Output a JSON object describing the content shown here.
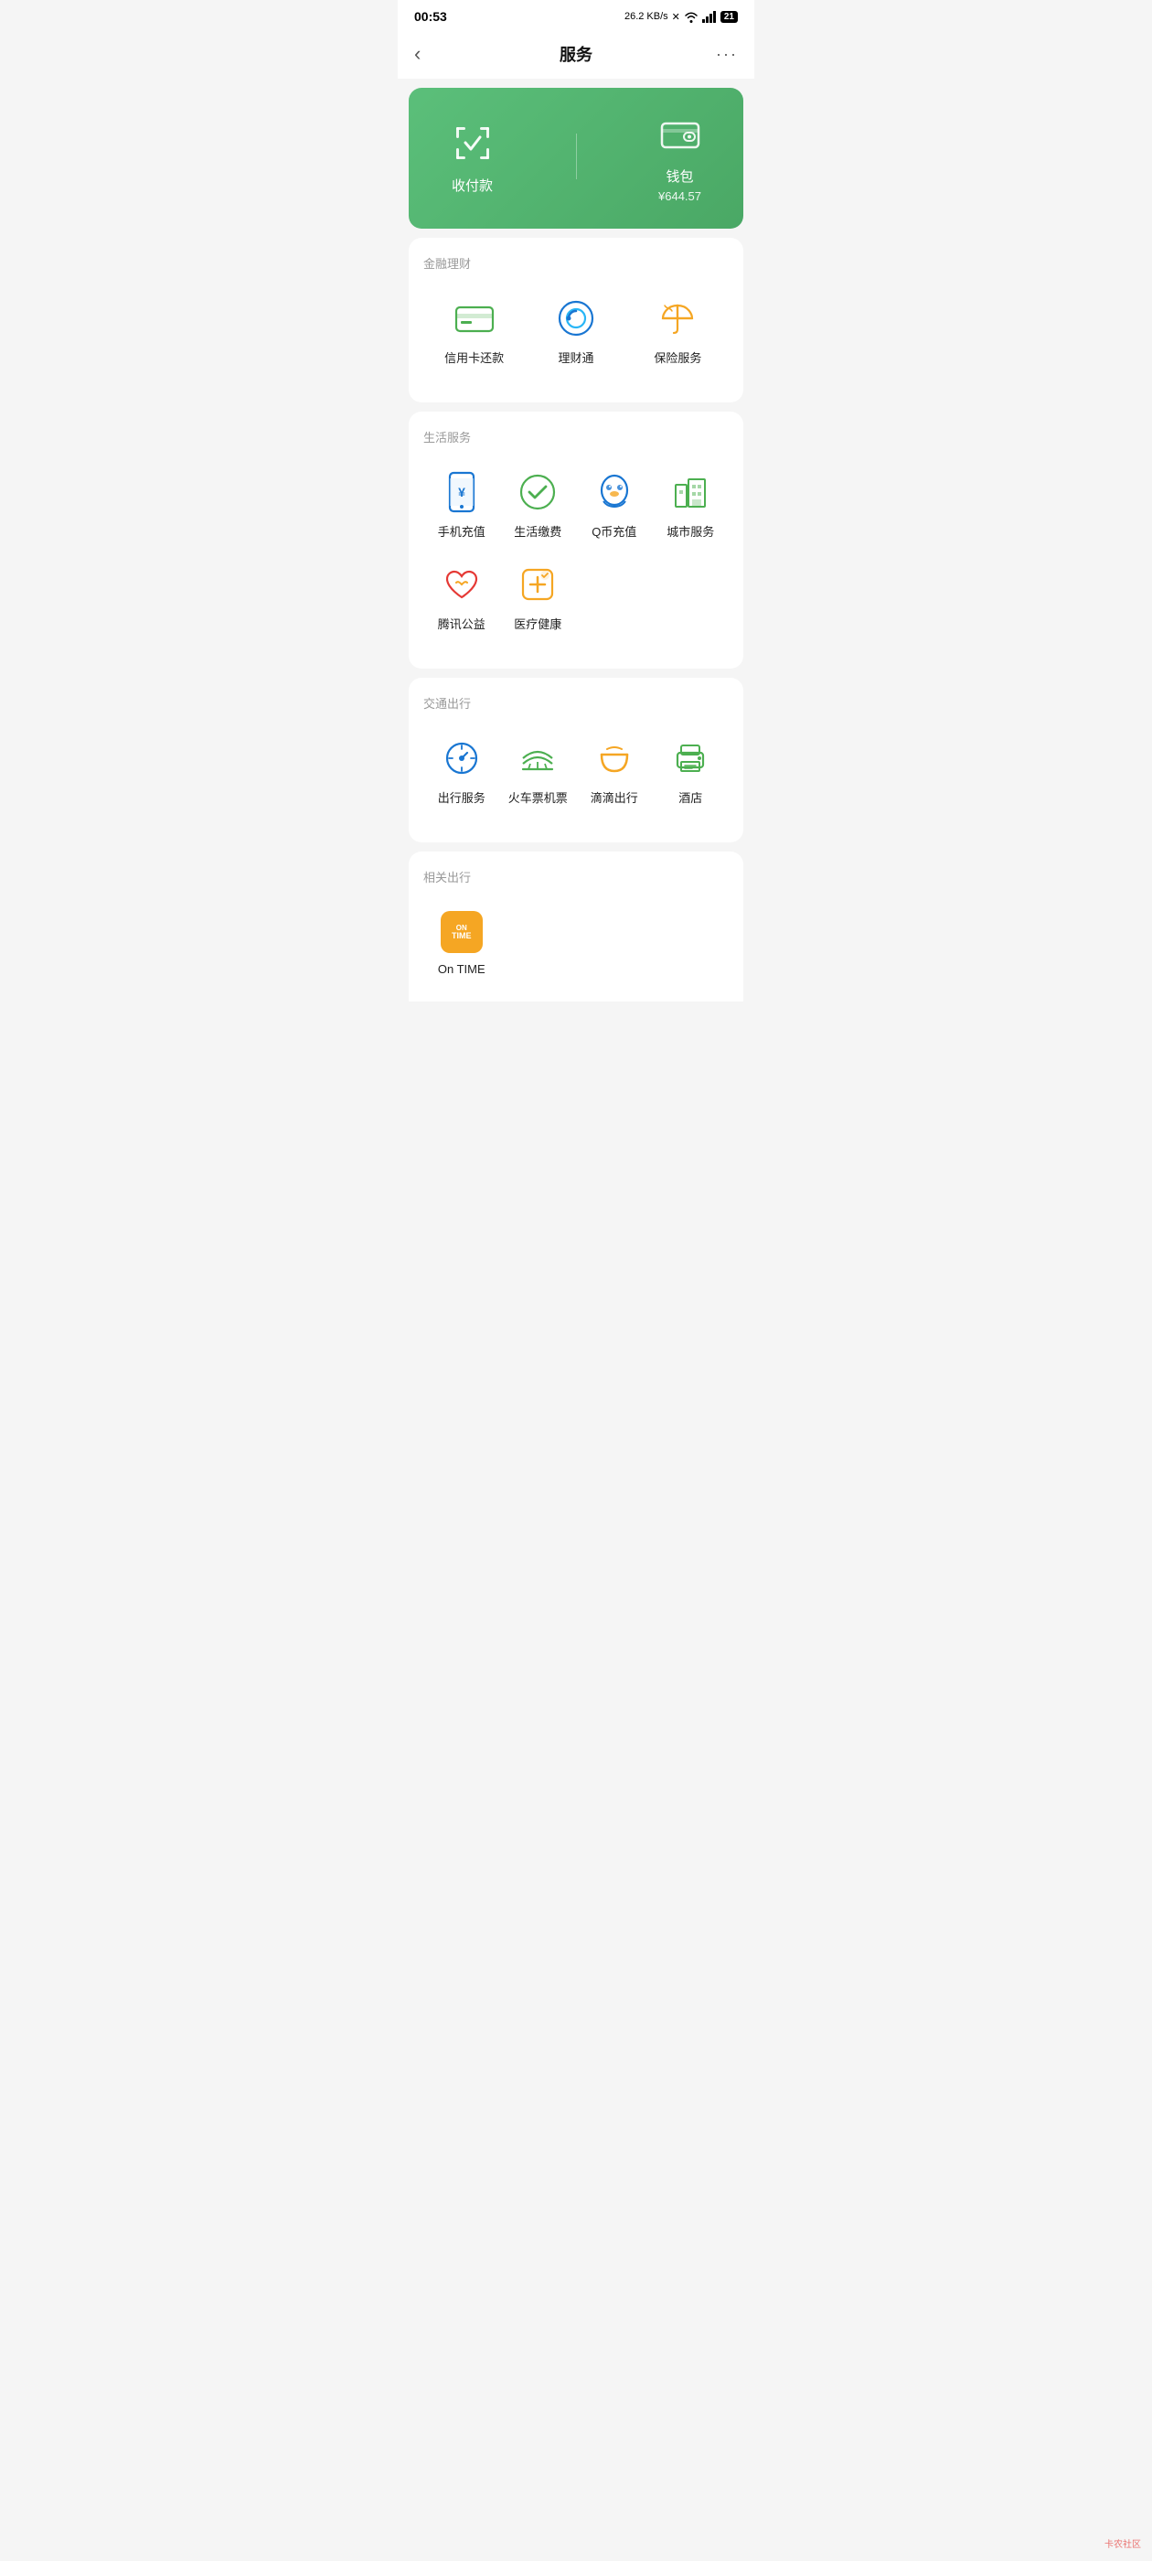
{
  "statusBar": {
    "time": "00:53",
    "speed": "26.2 KB/s",
    "battery": "21"
  },
  "header": {
    "backLabel": "‹",
    "title": "服务",
    "moreLabel": "···"
  },
  "banner": {
    "items": [
      {
        "id": "payment",
        "label": "收付款",
        "sublabel": null
      },
      {
        "id": "wallet",
        "label": "钱包",
        "sublabel": "¥644.57"
      }
    ]
  },
  "sections": [
    {
      "id": "finance",
      "title": "金融理财",
      "rows": [
        [
          {
            "id": "credit-card",
            "label": "信用卡还款",
            "iconType": "credit-card"
          },
          {
            "id": "wealth",
            "label": "理财通",
            "iconType": "wealth"
          },
          {
            "id": "insurance",
            "label": "保险服务",
            "iconType": "insurance"
          }
        ]
      ]
    },
    {
      "id": "life",
      "title": "生活服务",
      "rows": [
        [
          {
            "id": "mobile-topup",
            "label": "手机充值",
            "iconType": "mobile-topup"
          },
          {
            "id": "life-bills",
            "label": "生活缴费",
            "iconType": "life-bills"
          },
          {
            "id": "qcoin",
            "label": "Q币充值",
            "iconType": "qcoin"
          },
          {
            "id": "city-service",
            "label": "城市服务",
            "iconType": "city-service"
          }
        ],
        [
          {
            "id": "charity",
            "label": "腾讯公益",
            "iconType": "charity"
          },
          {
            "id": "health",
            "label": "医疗健康",
            "iconType": "health"
          }
        ]
      ]
    },
    {
      "id": "transport",
      "title": "交通出行",
      "rows": [
        [
          {
            "id": "travel",
            "label": "出行服务",
            "iconType": "travel"
          },
          {
            "id": "train",
            "label": "火车票机票",
            "iconType": "train"
          },
          {
            "id": "didi",
            "label": "滴滴出行",
            "iconType": "didi"
          },
          {
            "id": "hotel",
            "label": "酒店",
            "iconType": "hotel"
          }
        ]
      ]
    }
  ],
  "partialSection": {
    "title": "相关出行",
    "items": [
      {
        "id": "on-time",
        "label": "On TIME",
        "iconType": "on-time"
      }
    ]
  }
}
